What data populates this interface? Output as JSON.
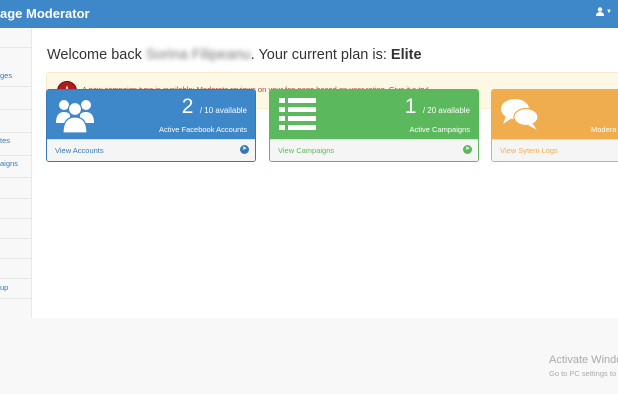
{
  "navbar": {
    "brand": "age Moderator",
    "user_icon": "user-icon",
    "caret_icon": "caret-down-icon"
  },
  "sidebar": {
    "items": [
      {
        "label": ""
      },
      {
        "label": "ges"
      },
      {
        "label": ""
      },
      {
        "label": ""
      },
      {
        "label": "tes"
      },
      {
        "label": "aigns"
      },
      {
        "label": ""
      },
      {
        "label": ""
      },
      {
        "label": ""
      },
      {
        "label": ""
      },
      {
        "label": ""
      },
      {
        "label": "up"
      }
    ]
  },
  "header": {
    "welcome": "Welcome back",
    "user_name": "Sorina Filipeanu",
    "plan_prefix": ". Your current plan is:",
    "plan": "Elite"
  },
  "alert": {
    "icon": "exclamation-icon",
    "text": "A new campaign type is available: Moderate reviews on your fan page based on user rating. Give it a try!"
  },
  "panels": [
    {
      "icon": "users-icon",
      "count": "2",
      "of_text": "/ 10 available",
      "label": "Active Facebook Accounts",
      "link": "View Accounts",
      "color": "#3e87c8"
    },
    {
      "icon": "list-icon",
      "count": "1",
      "of_text": "/ 20 available",
      "label": "Active Campaigns",
      "link": "View Campaigns",
      "color": "#5cb85c"
    },
    {
      "icon": "comments-icon",
      "label": "Modera",
      "link": "View Sytem Logs",
      "color": "#f0ad4e"
    }
  ],
  "watermark": {
    "line1": "Activate Windo",
    "line2": "Go to PC settings to"
  }
}
